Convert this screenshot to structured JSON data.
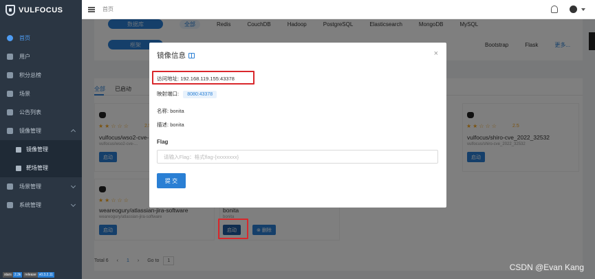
{
  "brand": {
    "name": "VULFOCUS"
  },
  "sidebar": {
    "items": [
      {
        "label": "首页"
      },
      {
        "label": "用户"
      },
      {
        "label": "积分总榜"
      },
      {
        "label": "场景"
      },
      {
        "label": "公告列表"
      },
      {
        "label": "镜像管理"
      },
      {
        "label": "镜像管理"
      },
      {
        "label": "靶场管理"
      },
      {
        "label": "场景管理"
      },
      {
        "label": "系统管理"
      }
    ],
    "footer": {
      "stars_label": "stars",
      "stars_value": "2.3k",
      "release_label": "release",
      "release_value": "v0.3.2.11"
    }
  },
  "topbar": {
    "breadcrumb": "首页"
  },
  "filters": {
    "row1": {
      "pill": "数据库",
      "selected": "全部",
      "options": [
        "Redis",
        "CouchDB",
        "Hadoop",
        "PostgreSQL",
        "Elasticsearch",
        "MongoDB",
        "MySQL"
      ]
    },
    "row2": {
      "pill": "框架",
      "options": [
        "Bootstrap",
        "Flask",
        "更多..."
      ]
    }
  },
  "tabs": {
    "all": "全部",
    "started": "已启动"
  },
  "cards": [
    {
      "rating": "2.5",
      "title": "vulfocus/wso2-cve-...",
      "subtitle": "vulfocus/wso2-cve-...",
      "button": "启动"
    },
    {
      "rating": "2.5",
      "title": "vulfocus/shiro-cve_2022_32532",
      "subtitle": "vulfocus/shiro-cve_2022_32532",
      "button": "启动"
    },
    {
      "title": "weareogury/atlassian-jira-software",
      "subtitle": "weareogury/atlassian-jira-software",
      "button": "启动"
    },
    {
      "title": "bonita",
      "subtitle": "bonita",
      "button": "启动",
      "button2": "删除"
    }
  ],
  "pagination": {
    "total": "Total 6",
    "prev": "‹",
    "page": "1",
    "next": "›",
    "goto_label": "Go to",
    "goto_value": "1"
  },
  "modal": {
    "title": "镜像信息",
    "address_label": "访问地址:",
    "address_value": "192.168.119.155:43378",
    "port_label": "映射端口:",
    "port_value": "8080:43378",
    "name_label": "名称:",
    "name_value": "bonita",
    "desc_label": "描述:",
    "desc_value": "bonita",
    "flag_label": "Flag",
    "flag_placeholder": "请输入Flag：格式flag-{xxxxxxxx}",
    "submit": "提 交",
    "close": "×"
  },
  "watermark": "CSDN @Evan Kang",
  "colors": {
    "sidebar": "#2b3643",
    "accent": "#2a7fd4",
    "annotation": "#d9272b",
    "star": "#f5a623"
  }
}
